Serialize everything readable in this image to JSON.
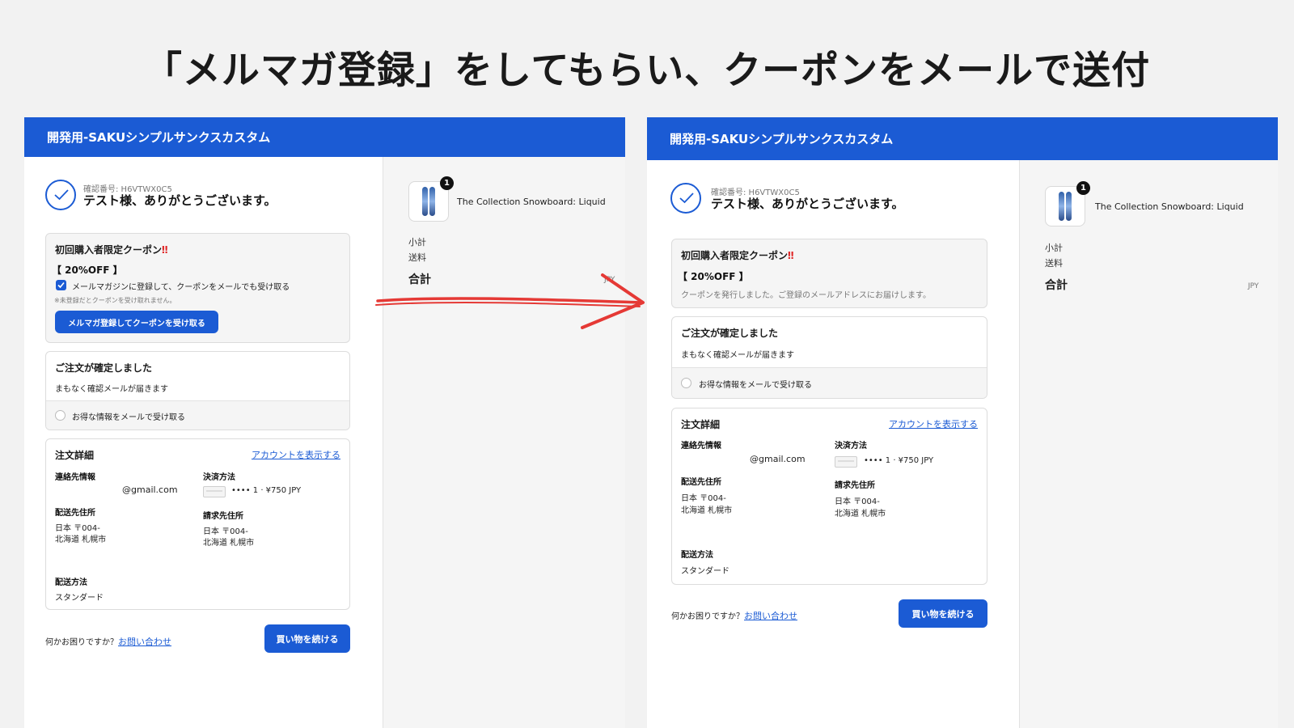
{
  "slide_title": "「メルマガ登録」をしてもらい、クーポンをメールで送付",
  "store_name": "開発用-SAKUシンプルサンクスカスタム",
  "confirmation_number": "確認番号: H6VTWX0C5",
  "thanks_message": "テスト様、ありがとうございます。",
  "coupon": {
    "title": "初回購入者限定クーポン",
    "title_mark": "‼",
    "discount": "【 20%OFF 】",
    "checkbox_label": "メールマガジンに登録して、クーポンをメールでも受け取る",
    "note": "※未登録だとクーポンを受け取れません。",
    "button": "メルマガ登録してクーポンを受け取る",
    "issued_message": "クーポンを発行しました。ご登録のメールアドレスにお届けします。"
  },
  "order_confirmed": {
    "title": "ご注文が確定しました",
    "subtitle": "まもなく確認メールが届きます",
    "marketing_opt_in": "お得な情報をメールで受け取る"
  },
  "order_details": {
    "title": "注文詳細",
    "account_link": "アカウントを表示する",
    "contact_label": "連絡先情報",
    "contact_value": "@gmail.com",
    "payment_label": "決済方法",
    "payment_value": "•••• 1 · ¥750 JPY",
    "shipping_address_label": "配送先住所",
    "shipping_address_line1": "日本 〒004-",
    "shipping_address_line2": "北海道 札幌市",
    "billing_address_label": "請求先住所",
    "billing_address_line1": "日本 〒004-",
    "billing_address_line2": "北海道 札幌市",
    "shipping_method_label": "配送方法",
    "shipping_method_value": "スタンダード"
  },
  "help": {
    "text": "何かお困りですか？",
    "link": "お問い合わせ"
  },
  "continue_button": "買い物を続ける",
  "summary": {
    "product_name": "The Collection Snowboard: Liquid",
    "quantity": "1",
    "subtotal_label": "小計",
    "shipping_label": "送料",
    "total_label": "合計",
    "currency": "JPY"
  },
  "colors": {
    "brand_blue": "#1b5bd4",
    "arrow_red": "#e53935",
    "alert_red": "#e02424"
  }
}
